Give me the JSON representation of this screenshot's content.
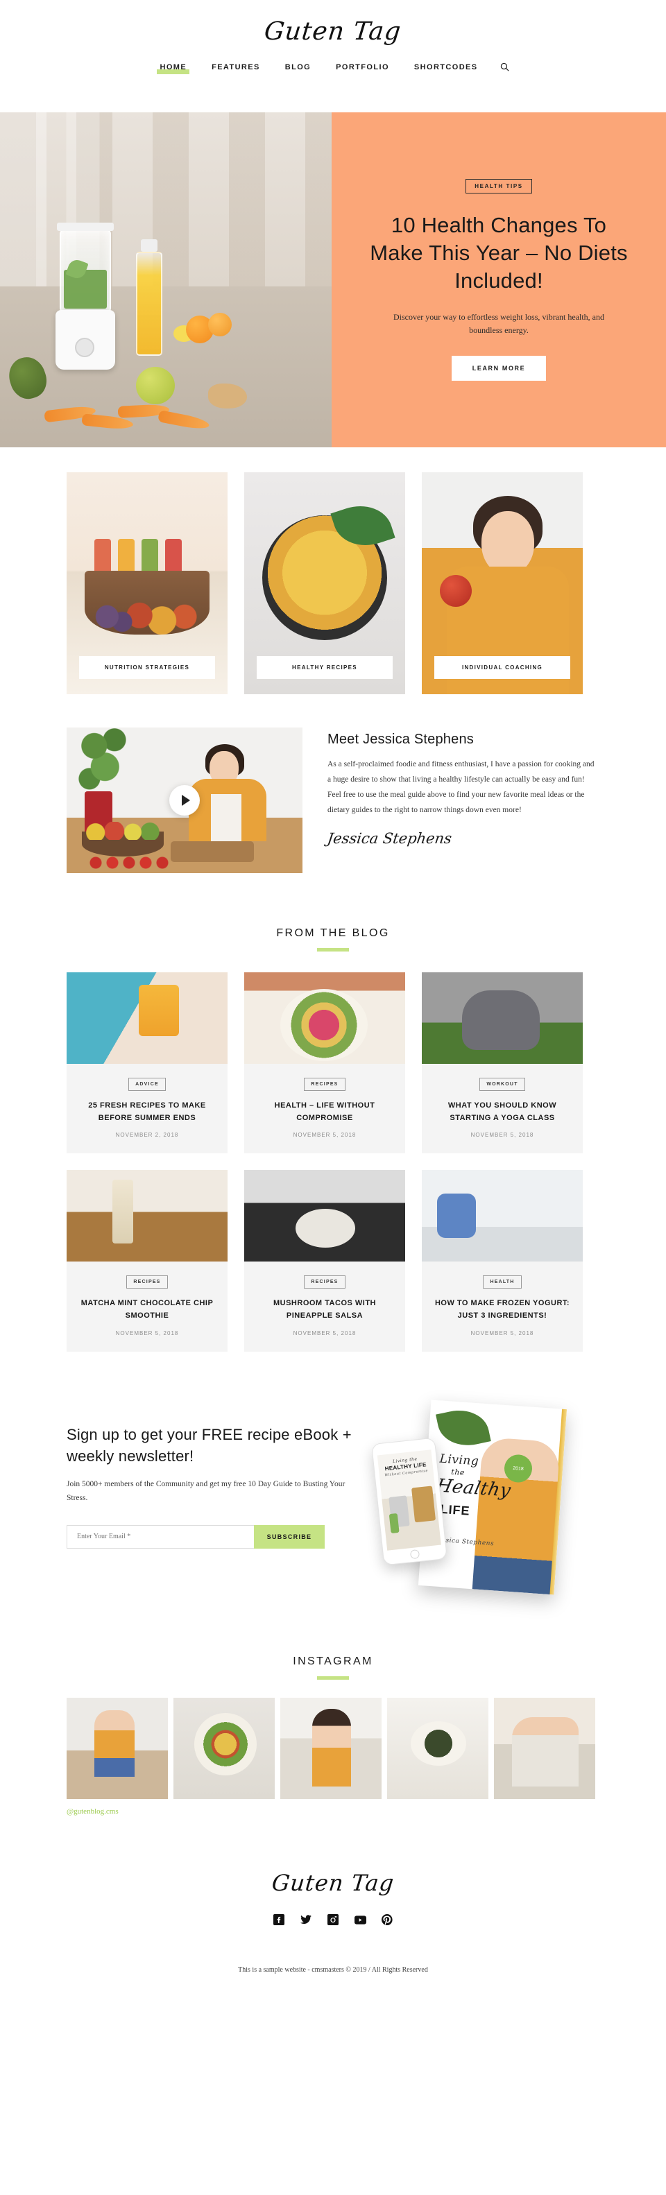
{
  "header": {
    "logo": "Guten Tag",
    "nav": [
      {
        "label": "HOME",
        "active": true
      },
      {
        "label": "FEATURES",
        "active": false
      },
      {
        "label": "BLOG",
        "active": false
      },
      {
        "label": "PORTFOLIO",
        "active": false
      },
      {
        "label": "SHORTCODES",
        "active": false
      }
    ],
    "search_icon": "search-icon",
    "accent_green": "#c5e384"
  },
  "hero": {
    "tag": "HEALTH TIPS",
    "title": "10 Health Changes To Make This Year – No Diets Included!",
    "subtitle": "Discover your way to effortless weight loss, vibrant health, and boundless energy.",
    "button": "LEARN MORE",
    "panel_color": "#fba678"
  },
  "categories": [
    {
      "label": "NUTRITION STRATEGIES"
    },
    {
      "label": "HEALTHY RECIPES"
    },
    {
      "label": "INDIVIDUAL COACHING"
    }
  ],
  "about": {
    "title": "Meet Jessica Stephens",
    "body": "As a self-proclaimed foodie and fitness enthusiast, I have a passion for cooking and a huge desire to show that living a healthy lifestyle can actually be easy and fun! Feel free to use the meal guide above to find your new favorite meal ideas or the dietary guides to the right to narrow things down even more!",
    "signature": "Jessica Stephens",
    "play_icon": "play-icon"
  },
  "blog": {
    "section_title": "FROM THE BLOG",
    "posts": [
      {
        "category": "ADVICE",
        "title": "25 FRESH RECIPES TO MAKE BEFORE SUMMER ENDS",
        "date": "NOVEMBER 2, 2018"
      },
      {
        "category": "RECIPES",
        "title": "HEALTH – LIFE WITHOUT COMPROMISE",
        "date": "NOVEMBER 5, 2018"
      },
      {
        "category": "WORKOUT",
        "title": "WHAT YOU SHOULD KNOW STARTING A YOGA CLASS",
        "date": "NOVEMBER 5, 2018"
      },
      {
        "category": "RECIPES",
        "title": "MATCHA MINT CHOCOLATE CHIP SMOOTHIE",
        "date": "NOVEMBER 5, 2018"
      },
      {
        "category": "RECIPES",
        "title": "MUSHROOM TACOS WITH PINEAPPLE SALSA",
        "date": "NOVEMBER 5, 2018"
      },
      {
        "category": "HEALTH",
        "title": "HOW TO MAKE FROZEN YOGURT: JUST 3 INGREDIENTS!",
        "date": "NOVEMBER 5, 2018"
      }
    ]
  },
  "newsletter": {
    "title": "Sign up to get your FREE recipe eBook + weekly newsletter!",
    "subtitle": "Join 5000+ members of the Community and get my free 10 Day Guide to Busting Your Stress.",
    "email_placeholder": "Enter Your Email *",
    "email_value": "",
    "button": "SUBSCRIBE",
    "button_color": "#c5e384",
    "ebook": {
      "line1": "Living",
      "line2": "the",
      "line3": "Healthy",
      "line4": "LIFE",
      "badge": "2018",
      "author": "Jessica Stephens"
    },
    "phone": {
      "line1": "Living the",
      "line2": "HEALTHY LIFE",
      "line3": "Without Compromise"
    }
  },
  "instagram": {
    "section_title": "INSTAGRAM",
    "handle": "@gutenblog.cms",
    "handle_color": "#9ccb4e",
    "cells": [
      {
        "alt": "woman-drinking-smoothie"
      },
      {
        "alt": "healthy-bowl-flatlay"
      },
      {
        "alt": "woman-portrait"
      },
      {
        "alt": "salad-bowls"
      },
      {
        "alt": "woman-sitting-blanket"
      }
    ]
  },
  "footer": {
    "logo": "Guten Tag",
    "socials": [
      {
        "name": "facebook-icon"
      },
      {
        "name": "twitter-icon"
      },
      {
        "name": "instagram-icon"
      },
      {
        "name": "youtube-icon"
      },
      {
        "name": "pinterest-icon"
      }
    ],
    "copyright": "This is a sample website - cmsmasters © 2019 / All Rights Reserved"
  }
}
